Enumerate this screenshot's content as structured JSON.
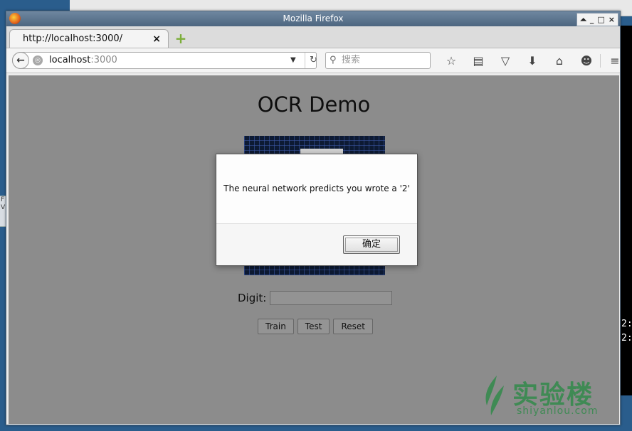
{
  "window": {
    "title": "Mozilla Firefox",
    "controls": [
      "⏶",
      "_",
      "□",
      "×"
    ]
  },
  "tab": {
    "label": "http://localhost:3000/",
    "close": "×",
    "new_tab": "+"
  },
  "url": {
    "host": "localhost",
    "port": ":3000",
    "dropdown": "▼",
    "reload": "↻"
  },
  "search": {
    "placeholder": "搜索",
    "icon": "search-icon"
  },
  "toolbar_icons": [
    {
      "name": "bookmark-star-icon",
      "glyph": "☆"
    },
    {
      "name": "reading-list-icon",
      "glyph": "▤"
    },
    {
      "name": "pocket-icon",
      "glyph": "▽"
    },
    {
      "name": "downloads-icon",
      "glyph": "⬇"
    },
    {
      "name": "home-icon",
      "glyph": "⌂"
    },
    {
      "name": "chat-icon",
      "glyph": "☻"
    },
    {
      "name": "menu-icon",
      "glyph": "≡"
    }
  ],
  "page": {
    "title": "OCR Demo",
    "digit_label": "Digit:",
    "digit_value": "",
    "buttons": {
      "train": "Train",
      "test": "Test",
      "reset": "Reset"
    }
  },
  "dialog": {
    "message": "The neural network predicts you wrote a '2'",
    "ok_label": "确定"
  },
  "watermark": {
    "main": "实验楼",
    "sub": "shiyanlou.com"
  },
  "colors": {
    "viewport_bg": "#8c8c8c",
    "canvas_bg": "#0d1a33",
    "brand_green": "#3f8a54"
  }
}
